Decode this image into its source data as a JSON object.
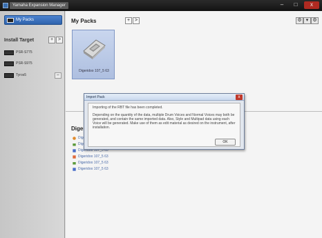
{
  "window": {
    "title": "Yamaha Expansion Manager",
    "minimize": "–",
    "maximize": "□",
    "close": "x"
  },
  "sidebar": {
    "my_packs": "My Packs",
    "install_target_label": "Install Target",
    "add_target": "+",
    "more_target": ">",
    "devices": [
      {
        "name": "PSR-S775",
        "icon": "keyboard-icon"
      },
      {
        "name": "PSR-S975",
        "icon": "keyboard-icon"
      },
      {
        "name": "Tyros5",
        "icon": "keyboard-icon",
        "action": "⇔"
      }
    ]
  },
  "main": {
    "title": "My Packs",
    "add_pack": "+",
    "pack_nav": ">",
    "view_buttons": [
      "⚙",
      "▾",
      "⚙"
    ],
    "pack": {
      "name": "Digeridoo 107_5 63"
    },
    "contents_title": "Digeridoo",
    "contents": [
      {
        "name": "Digeridoo 107_5 63",
        "icon": "voice-icon",
        "color": "#e08a2c"
      },
      {
        "name": "Digeridoo 107_5 63",
        "icon": "drum-icon",
        "color": "#5c9b3c"
      },
      {
        "name": "Digeridoo 107_5 63",
        "icon": "grid-icon",
        "color": "#4a6ec9"
      },
      {
        "name": "Digeridoo 107_5 63",
        "icon": "grid-icon",
        "color": "#e06a3a"
      },
      {
        "name": "Digeridoo 107_5 63",
        "icon": "drum-icon",
        "color": "#5c9b3c"
      },
      {
        "name": "Digeridoo 107_5 63",
        "icon": "grid-icon",
        "color": "#4a6ec9"
      }
    ]
  },
  "dialog": {
    "title": "Import Pack",
    "close": "x",
    "message1": "Importing of the RBT file has been completed.",
    "message2": "Depending on the quantity of the data, multiple Drum Voices and Normal Voices may both be generated, and contain the same imported data. Also, Style and Multipad data using each Voice will be generated. Make use of them as edit material as desired on the instrument, after installation.",
    "ok_label": "OK"
  },
  "colors": {
    "selection": "#3a6fc0",
    "titlebar": "#1d1d1d",
    "dialog_close": "#c0392b"
  }
}
